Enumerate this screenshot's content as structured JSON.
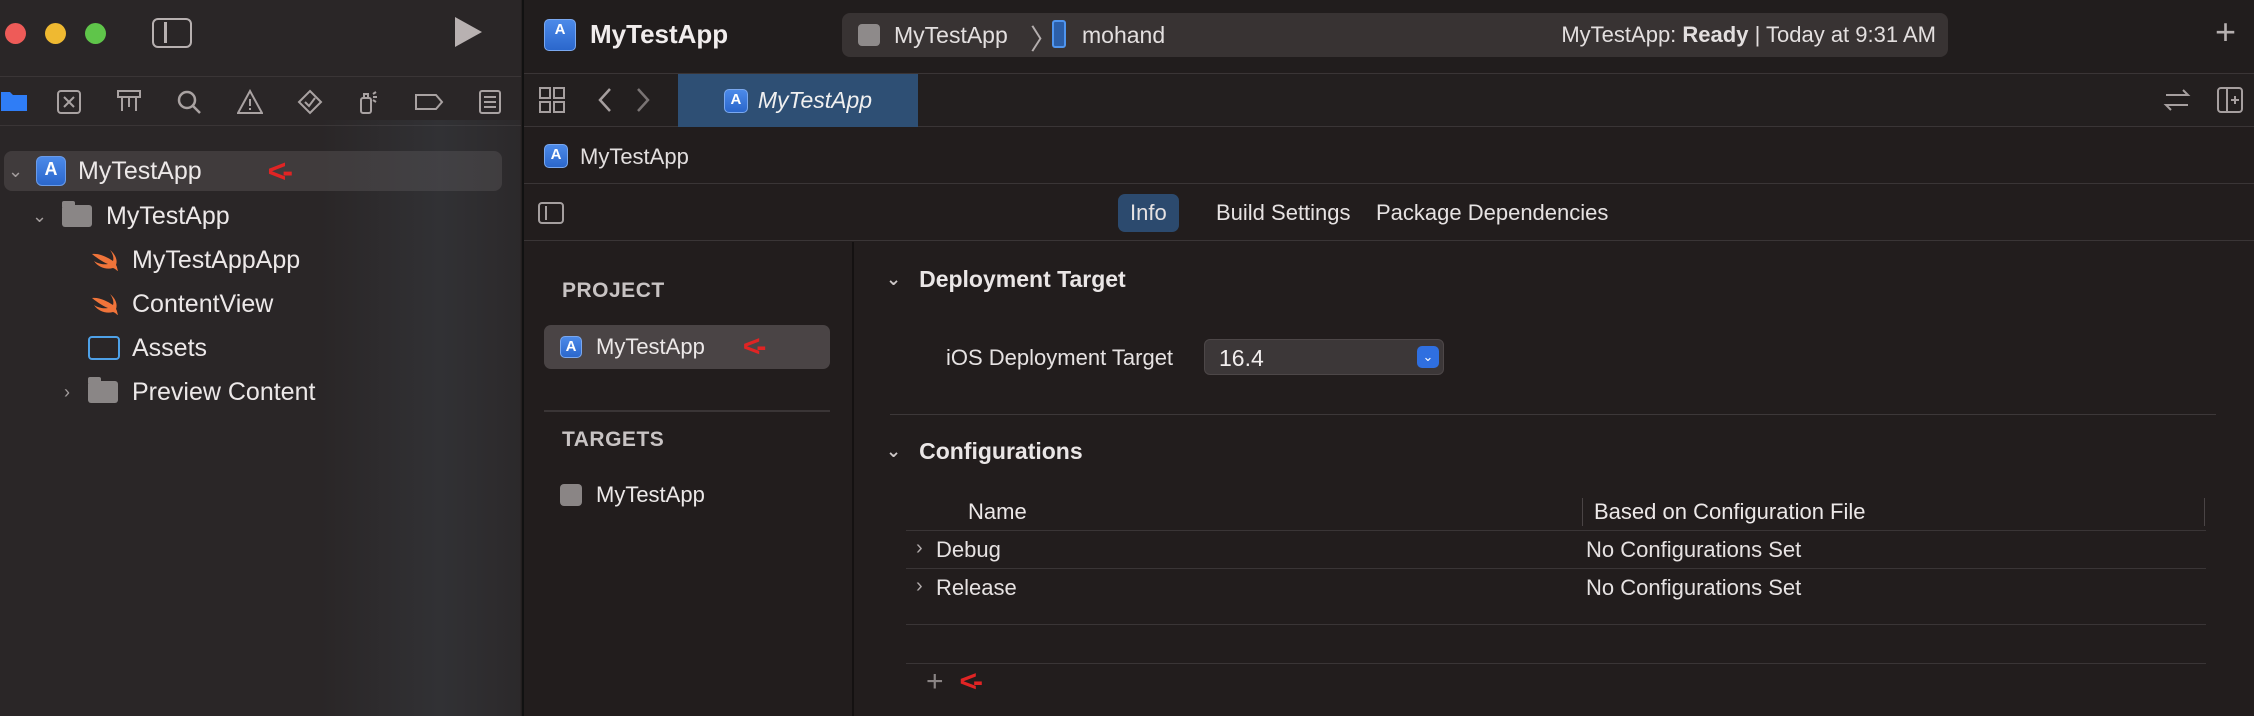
{
  "navigator": {
    "tree": [
      {
        "label": "MyTestApp",
        "annotation": "<-"
      },
      {
        "label": "MyTestApp"
      },
      {
        "label": "MyTestAppApp"
      },
      {
        "label": "ContentView"
      },
      {
        "label": "Assets"
      },
      {
        "label": "Preview Content"
      }
    ]
  },
  "titlebar": {
    "app_title": "MyTestApp",
    "scheme": "MyTestApp",
    "separator": "〉",
    "device": "mohand",
    "status_prefix": "MyTestApp: ",
    "status_bold": "Ready",
    "status_suffix": " | Today at 9:31 AM",
    "add_label": "+"
  },
  "editor_tab": {
    "label": "MyTestApp"
  },
  "jumpbar": {
    "label": "MyTestApp"
  },
  "segments": [
    {
      "label": "Info",
      "active": true
    },
    {
      "label": "Build Settings"
    },
    {
      "label": "Package Dependencies"
    }
  ],
  "project_list": {
    "project_header": "PROJECT",
    "project_item": "MyTestApp",
    "project_annotation": "<-",
    "targets_header": "TARGETS",
    "target_item": "MyTestApp"
  },
  "deployment": {
    "section_title": "Deployment Target",
    "field_label": "iOS Deployment Target",
    "field_value": "16.4"
  },
  "configurations": {
    "section_title": "Configurations",
    "columns": [
      "Name",
      "Based on Configuration File"
    ],
    "rows": [
      {
        "name": "Debug",
        "based": "No Configurations Set"
      },
      {
        "name": "Release",
        "based": "No Configurations Set"
      }
    ],
    "add_label": "+",
    "add_annotation": "<-"
  },
  "colors": {
    "accent": "#2c4a6e",
    "annotation": "#e02424",
    "app_icon": "#3a7ae0"
  }
}
